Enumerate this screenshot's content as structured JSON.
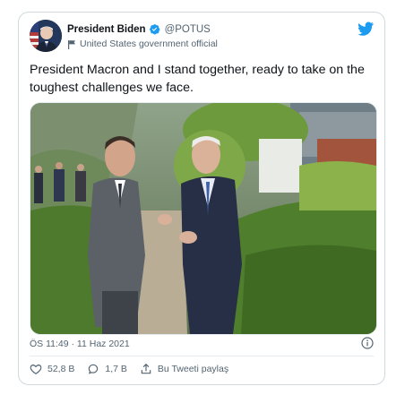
{
  "tweet": {
    "author_name": "President Biden",
    "handle": "@POTUS",
    "affiliation": "United States government official",
    "text": "President Macron and I stand together, ready to take on the toughest challenges we face.",
    "timestamp": "ÖS 11:49 · 11 Haz 2021",
    "likes": "52,8 B",
    "replies": "1,7 B",
    "share_label": "Bu Tweeti paylaş"
  },
  "icons": {
    "verified": "verified-badge-icon",
    "affiliation": "flag-icon",
    "brand": "twitter-bird-icon",
    "info": "info-icon",
    "like": "heart-icon",
    "reply": "reply-bubble-icon",
    "share": "share-icon"
  },
  "colors": {
    "accent": "#1d9bf0",
    "text": "#0f1419",
    "secondary": "#536471",
    "border": "#cfd9de"
  }
}
